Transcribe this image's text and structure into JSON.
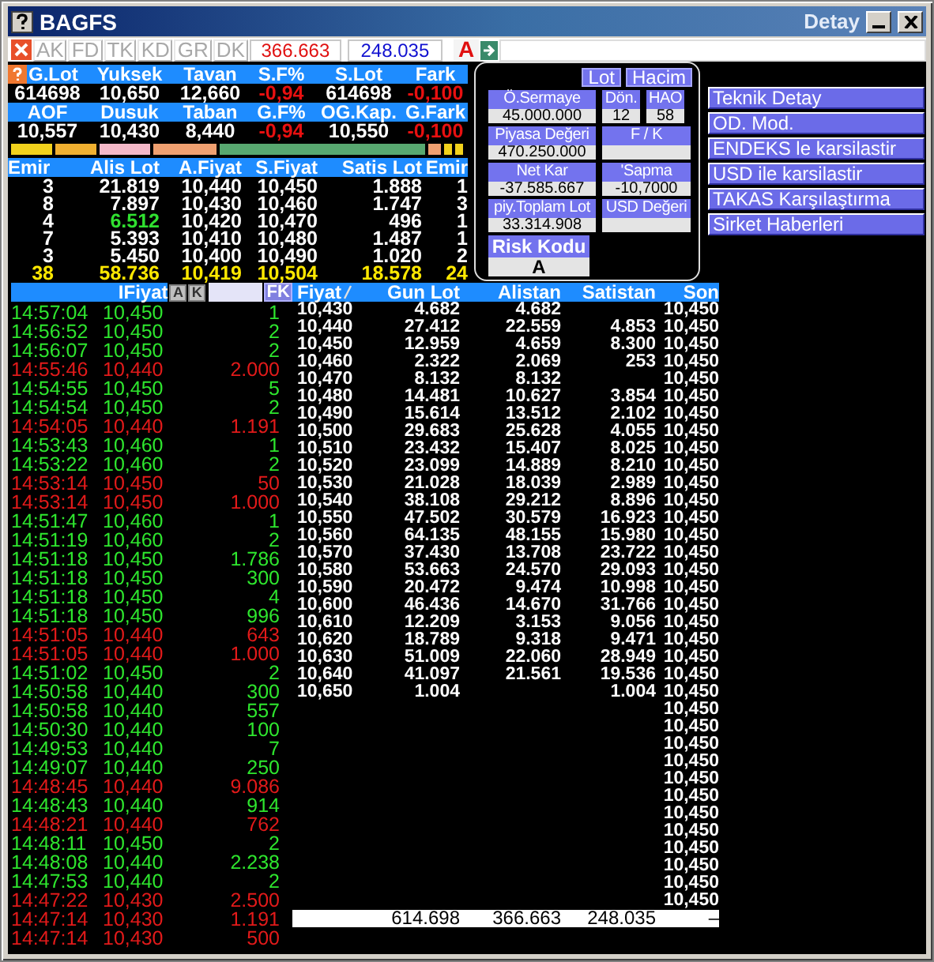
{
  "window": {
    "title": "BAGFS",
    "caption_right": "Detay"
  },
  "toolbar": {
    "tabs": [
      "AK",
      "FD",
      "TK",
      "KD",
      "GR",
      "DK"
    ],
    "first_total": "366.663",
    "second_total": "248.035",
    "mode": "A"
  },
  "summary": [
    {
      "headers": [
        "G.Lot",
        "Yuksek",
        "Tavan",
        "S.F%",
        "S.Lot",
        "Fark"
      ],
      "values": [
        {
          "text": "614698",
          "negative": false
        },
        {
          "text": "10,650",
          "negative": false
        },
        {
          "text": "12,660",
          "negative": false
        },
        {
          "text": "-0,94",
          "negative": true
        },
        {
          "text": "614698",
          "negative": false
        },
        {
          "text": "-0,100",
          "negative": true
        }
      ]
    },
    {
      "headers": [
        "AOF",
        "Dusuk",
        "Taban",
        "G.F%",
        "OG.Kap.",
        "G.Fark"
      ],
      "values": [
        {
          "text": "10,557",
          "negative": false
        },
        {
          "text": "10,430",
          "negative": false
        },
        {
          "text": "8,440",
          "negative": false
        },
        {
          "text": "-0,94",
          "negative": true
        },
        {
          "text": "10,550",
          "negative": false
        },
        {
          "text": "-0,100",
          "negative": true
        }
      ]
    }
  ],
  "depth_bar": [
    {
      "color": "#f2d21c"
    },
    {
      "color": "#f0b030"
    },
    {
      "color": "#f4b8c8"
    },
    {
      "color": "#f0a070"
    },
    {
      "color": "#58a870"
    },
    {
      "color": "#f0a070"
    },
    {
      "color": "#f2d21c"
    },
    {
      "color": "#f2d21c"
    }
  ],
  "order_book": {
    "columns": [
      "Emir",
      "Alis Lot",
      "A.Fiyat",
      "S.Fiyat",
      "Satis Lot",
      "Emir"
    ],
    "rows": [
      {
        "cells": [
          "3",
          "21.819",
          "10,440",
          "10,450",
          "1.888",
          "1"
        ],
        "bid_lot_changed": false
      },
      {
        "cells": [
          "8",
          "7.897",
          "10,430",
          "10,460",
          "1.747",
          "3"
        ],
        "bid_lot_changed": false
      },
      {
        "cells": [
          "4",
          "6.512",
          "10,420",
          "10,470",
          "496",
          "1"
        ],
        "bid_lot_changed": true
      },
      {
        "cells": [
          "7",
          "5.393",
          "10,410",
          "10,480",
          "1.487",
          "1"
        ],
        "bid_lot_changed": false
      },
      {
        "cells": [
          "3",
          "5.450",
          "10,400",
          "10,490",
          "1.020",
          "2"
        ],
        "bid_lot_changed": false
      }
    ],
    "total": [
      "38",
      "58.736",
      "10,419",
      "10,504",
      "18.578",
      "24"
    ]
  },
  "trades": {
    "price_label": "IFiyat",
    "buttons": [
      "A",
      "K"
    ],
    "filter": "FK",
    "rows": [
      {
        "time": "14:57:04",
        "price": "10,450",
        "lot": "1",
        "kind": "buy"
      },
      {
        "time": "14:56:52",
        "price": "10,450",
        "lot": "2",
        "kind": "buy"
      },
      {
        "time": "14:56:07",
        "price": "10,450",
        "lot": "2",
        "kind": "buy"
      },
      {
        "time": "14:55:46",
        "price": "10,440",
        "lot": "2.000",
        "kind": "sell"
      },
      {
        "time": "14:54:55",
        "price": "10,450",
        "lot": "5",
        "kind": "buy"
      },
      {
        "time": "14:54:54",
        "price": "10,450",
        "lot": "2",
        "kind": "buy"
      },
      {
        "time": "14:54:05",
        "price": "10,440",
        "lot": "1.191",
        "kind": "sell"
      },
      {
        "time": "14:53:43",
        "price": "10,460",
        "lot": "1",
        "kind": "buy"
      },
      {
        "time": "14:53:22",
        "price": "10,460",
        "lot": "2",
        "kind": "buy"
      },
      {
        "time": "14:53:14",
        "price": "10,450",
        "lot": "50",
        "kind": "sell"
      },
      {
        "time": "14:53:14",
        "price": "10,450",
        "lot": "1.000",
        "kind": "sell"
      },
      {
        "time": "14:51:47",
        "price": "10,460",
        "lot": "1",
        "kind": "buy"
      },
      {
        "time": "14:51:19",
        "price": "10,460",
        "lot": "2",
        "kind": "buy"
      },
      {
        "time": "14:51:18",
        "price": "10,450",
        "lot": "1.786",
        "kind": "buy"
      },
      {
        "time": "14:51:18",
        "price": "10,450",
        "lot": "300",
        "kind": "buy"
      },
      {
        "time": "14:51:18",
        "price": "10,450",
        "lot": "4",
        "kind": "buy"
      },
      {
        "time": "14:51:18",
        "price": "10,450",
        "lot": "996",
        "kind": "buy"
      },
      {
        "time": "14:51:05",
        "price": "10,440",
        "lot": "643",
        "kind": "sell"
      },
      {
        "time": "14:51:05",
        "price": "10,440",
        "lot": "1.000",
        "kind": "sell"
      },
      {
        "time": "14:51:02",
        "price": "10,450",
        "lot": "2",
        "kind": "buy"
      },
      {
        "time": "14:50:58",
        "price": "10,440",
        "lot": "300",
        "kind": "buy"
      },
      {
        "time": "14:50:58",
        "price": "10,440",
        "lot": "557",
        "kind": "buy"
      },
      {
        "time": "14:50:30",
        "price": "10,440",
        "lot": "100",
        "kind": "buy"
      },
      {
        "time": "14:49:53",
        "price": "10,440",
        "lot": "7",
        "kind": "buy"
      },
      {
        "time": "14:49:07",
        "price": "10,440",
        "lot": "250",
        "kind": "buy"
      },
      {
        "time": "14:48:45",
        "price": "10,440",
        "lot": "9.086",
        "kind": "sell"
      },
      {
        "time": "14:48:43",
        "price": "10,440",
        "lot": "914",
        "kind": "buy"
      },
      {
        "time": "14:48:21",
        "price": "10,440",
        "lot": "762",
        "kind": "sell"
      },
      {
        "time": "14:48:11",
        "price": "10,450",
        "lot": "2",
        "kind": "buy"
      },
      {
        "time": "14:48:08",
        "price": "10,440",
        "lot": "2.238",
        "kind": "buy"
      },
      {
        "time": "14:47:53",
        "price": "10,440",
        "lot": "2",
        "kind": "buy"
      },
      {
        "time": "14:47:22",
        "price": "10,430",
        "lot": "2.500",
        "kind": "sell"
      },
      {
        "time": "14:47:14",
        "price": "10,430",
        "lot": "1.191",
        "kind": "sell"
      },
      {
        "time": "14:47:14",
        "price": "10,430",
        "lot": "500",
        "kind": "sell"
      }
    ]
  },
  "price_table": {
    "columns": [
      "Fiyat",
      "Gun Lot",
      "Alistan",
      "Satistan",
      "Son"
    ],
    "rows": [
      {
        "price": "10,430",
        "day_lot": "4.682",
        "bid": "4.682",
        "last": "10,450"
      },
      {
        "price": "10,440",
        "day_lot": "27.412",
        "bid": "22.559",
        "ask": "4.853",
        "last": "10,450"
      },
      {
        "price": "10,450",
        "day_lot": "12.959",
        "bid": "4.659",
        "ask": "8.300",
        "last": "10,450"
      },
      {
        "price": "10,460",
        "day_lot": "2.322",
        "bid": "2.069",
        "ask": "253",
        "last": "10,450"
      },
      {
        "price": "10,470",
        "day_lot": "8.132",
        "bid": "8.132",
        "last": "10,450"
      },
      {
        "price": "10,480",
        "day_lot": "14.481",
        "bid": "10.627",
        "ask": "3.854",
        "last": "10,450"
      },
      {
        "price": "10,490",
        "day_lot": "15.614",
        "bid": "13.512",
        "ask": "2.102",
        "last": "10,450"
      },
      {
        "price": "10,500",
        "day_lot": "29.683",
        "bid": "25.628",
        "ask": "4.055",
        "last": "10,450"
      },
      {
        "price": "10,510",
        "day_lot": "23.432",
        "bid": "15.407",
        "ask": "8.025",
        "last": "10,450"
      },
      {
        "price": "10,520",
        "day_lot": "23.099",
        "bid": "14.889",
        "ask": "8.210",
        "last": "10,450"
      },
      {
        "price": "10,530",
        "day_lot": "21.028",
        "bid": "18.039",
        "ask": "2.989",
        "last": "10,450"
      },
      {
        "price": "10,540",
        "day_lot": "38.108",
        "bid": "29.212",
        "ask": "8.896",
        "last": "10,450"
      },
      {
        "price": "10,550",
        "day_lot": "47.502",
        "bid": "30.579",
        "ask": "16.923",
        "last": "10,450"
      },
      {
        "price": "10,560",
        "day_lot": "64.135",
        "bid": "48.155",
        "ask": "15.980",
        "last": "10,450"
      },
      {
        "price": "10,570",
        "day_lot": "37.430",
        "bid": "13.708",
        "ask": "23.722",
        "last": "10,450"
      },
      {
        "price": "10,580",
        "day_lot": "53.663",
        "bid": "24.570",
        "ask": "29.093",
        "last": "10,450"
      },
      {
        "price": "10,590",
        "day_lot": "20.472",
        "bid": "9.474",
        "ask": "10.998",
        "last": "10,450"
      },
      {
        "price": "10,600",
        "day_lot": "46.436",
        "bid": "14.670",
        "ask": "31.766",
        "last": "10,450"
      },
      {
        "price": "10,610",
        "day_lot": "12.209",
        "bid": "3.153",
        "ask": "9.056",
        "last": "10,450"
      },
      {
        "price": "10,620",
        "day_lot": "18.789",
        "bid": "9.318",
        "ask": "9.471",
        "last": "10,450"
      },
      {
        "price": "10,630",
        "day_lot": "51.009",
        "bid": "22.060",
        "ask": "28.949",
        "last": "10,450"
      },
      {
        "price": "10,640",
        "day_lot": "41.097",
        "bid": "21.561",
        "ask": "19.536",
        "last": "10,450"
      },
      {
        "price": "10,650",
        "day_lot": "1.004",
        "ask": "1.004",
        "last": "10,450"
      },
      {
        "last": "10,450"
      },
      {
        "last": "10,450"
      },
      {
        "last": "10,450"
      },
      {
        "last": "10,450"
      },
      {
        "last": "10,450"
      },
      {
        "last": "10,450"
      },
      {
        "last": "10,450"
      },
      {
        "last": "10,450"
      },
      {
        "last": "10,450"
      },
      {
        "last": "10,450"
      },
      {
        "last": "10,450"
      },
      {
        "last": "10,450"
      }
    ],
    "totals": {
      "day_lot": "614.698",
      "bid": "366.663",
      "ask": "248.035",
      "last": "–"
    }
  },
  "details": {
    "units": [
      "Lot",
      "Hacim"
    ],
    "rows": [
      [
        {
          "label": "Ö.Sermaye",
          "value": "45.000.000"
        },
        {
          "label": "Dön.",
          "value": "12"
        },
        {
          "label": "HAO",
          "value": "58"
        }
      ],
      [
        {
          "label": "Piyasa Değeri",
          "value": "470.250.000"
        },
        {
          "label": "F / K"
        }
      ],
      [
        {
          "label": "Net Kar",
          "value": "-37.585.667"
        },
        {
          "label": "'Sapma",
          "value": "-10,7000"
        }
      ],
      [
        {
          "label": "piy.Toplam Lot",
          "value": "33.314.908"
        },
        {
          "label": "USD Değeri"
        }
      ]
    ],
    "risk": {
      "label": "Risk Kodu",
      "value": "A"
    }
  },
  "actions": [
    "Teknik Detay",
    "OD. Mod.",
    "ENDEKS le karsilastir",
    "USD ile karsilastir",
    "TAKAS Karşılaştırma",
    "Sirket Haberleri"
  ]
}
